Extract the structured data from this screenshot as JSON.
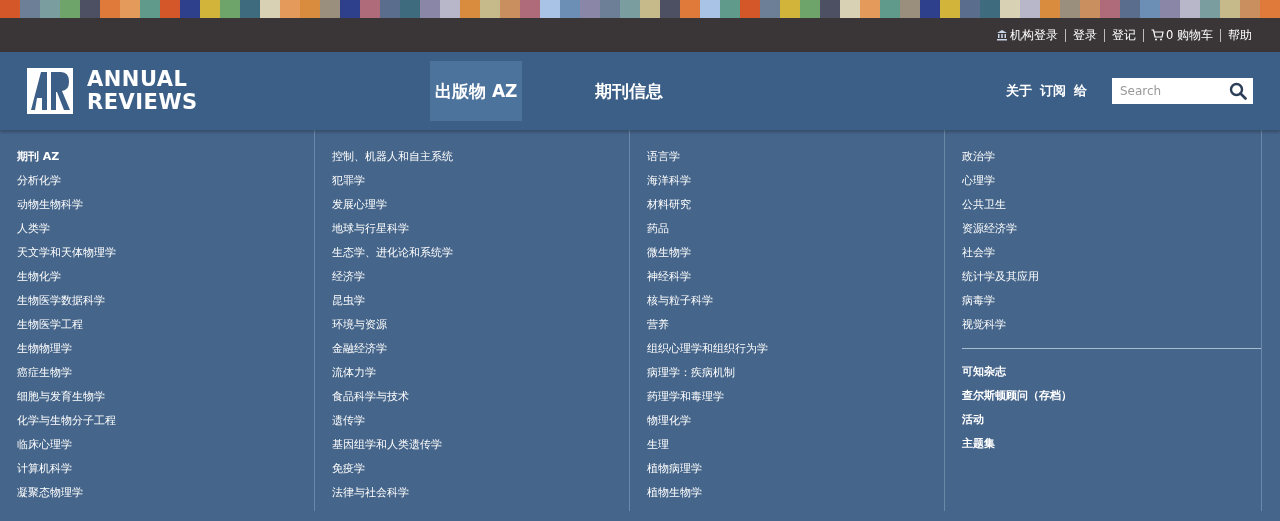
{
  "top_links": [
    {
      "label": "机构登录",
      "kind": "institution"
    },
    {
      "label": "登录",
      "kind": "plain"
    },
    {
      "label": "登记",
      "kind": "plain"
    },
    {
      "label": "0 购物车",
      "kind": "cart"
    },
    {
      "label": "帮助",
      "kind": "plain"
    }
  ],
  "logo": {
    "line_1": "ANNUAL",
    "line_2": "REVIEWS"
  },
  "nav": [
    {
      "label": "出版物 AZ",
      "selected": true
    },
    {
      "label": "期刊信息",
      "selected": false
    }
  ],
  "utility_links": [
    "关于",
    "订阅",
    "给"
  ],
  "search": {
    "placeholder": "Search"
  },
  "menu_columns": [
    {
      "items": [
        {
          "label": "期刊 AZ",
          "kind": "heading"
        },
        {
          "label": "分析化学",
          "kind": "link"
        },
        {
          "label": "动物生物科学",
          "kind": "link"
        },
        {
          "label": "人类学",
          "kind": "link"
        },
        {
          "label": "天文学和天体物理学",
          "kind": "link"
        },
        {
          "label": "生物化学",
          "kind": "link"
        },
        {
          "label": "生物医学数据科学",
          "kind": "link"
        },
        {
          "label": "生物医学工程",
          "kind": "link"
        },
        {
          "label": "生物物理学",
          "kind": "link"
        },
        {
          "label": "癌症生物学",
          "kind": "link"
        },
        {
          "label": "细胞与发育生物学",
          "kind": "link"
        },
        {
          "label": "化学与生物分子工程",
          "kind": "link"
        },
        {
          "label": "临床心理学",
          "kind": "link"
        },
        {
          "label": "计算机科学",
          "kind": "link"
        },
        {
          "label": "凝聚态物理学",
          "kind": "link"
        }
      ]
    },
    {
      "items": [
        {
          "label": "控制、机器人和自主系统",
          "kind": "link"
        },
        {
          "label": "犯罪学",
          "kind": "link"
        },
        {
          "label": "发展心理学",
          "kind": "link"
        },
        {
          "label": "地球与行星科学",
          "kind": "link"
        },
        {
          "label": "生态学、进化论和系统学",
          "kind": "link"
        },
        {
          "label": "经济学",
          "kind": "link"
        },
        {
          "label": "昆虫学",
          "kind": "link"
        },
        {
          "label": "环境与资源",
          "kind": "link"
        },
        {
          "label": "金融经济学",
          "kind": "link"
        },
        {
          "label": "流体力学",
          "kind": "link"
        },
        {
          "label": "食品科学与技术",
          "kind": "link"
        },
        {
          "label": "遗传学",
          "kind": "link"
        },
        {
          "label": "基因组学和人类遗传学",
          "kind": "link"
        },
        {
          "label": "免疫学",
          "kind": "link"
        },
        {
          "label": "法律与社会科学",
          "kind": "link"
        }
      ]
    },
    {
      "items": [
        {
          "label": "语言学",
          "kind": "link"
        },
        {
          "label": "海洋科学",
          "kind": "link"
        },
        {
          "label": "材料研究",
          "kind": "link"
        },
        {
          "label": "药品",
          "kind": "link"
        },
        {
          "label": "微生物学",
          "kind": "link"
        },
        {
          "label": "神经科学",
          "kind": "link"
        },
        {
          "label": "核与粒子科学",
          "kind": "link"
        },
        {
          "label": "营养",
          "kind": "link"
        },
        {
          "label": "组织心理学和组织行为学",
          "kind": "link"
        },
        {
          "label": "病理学：疾病机制",
          "kind": "link"
        },
        {
          "label": "药理学和毒理学",
          "kind": "link"
        },
        {
          "label": "物理化学",
          "kind": "link"
        },
        {
          "label": "生理",
          "kind": "link"
        },
        {
          "label": "植物病理学",
          "kind": "link"
        },
        {
          "label": "植物生物学",
          "kind": "link"
        }
      ]
    },
    {
      "items": [
        {
          "label": "政治学",
          "kind": "link"
        },
        {
          "label": "心理学",
          "kind": "link"
        },
        {
          "label": "公共卫生",
          "kind": "link"
        },
        {
          "label": "资源经济学",
          "kind": "link"
        },
        {
          "label": "社会学",
          "kind": "link"
        },
        {
          "label": "统计学及其应用",
          "kind": "link"
        },
        {
          "label": "病毒学",
          "kind": "link"
        },
        {
          "label": "视觉科学",
          "kind": "link"
        }
      ],
      "featured": [
        "可知杂志",
        "查尔斯顿顾问（存档）",
        "活动",
        "主题集"
      ]
    }
  ]
}
